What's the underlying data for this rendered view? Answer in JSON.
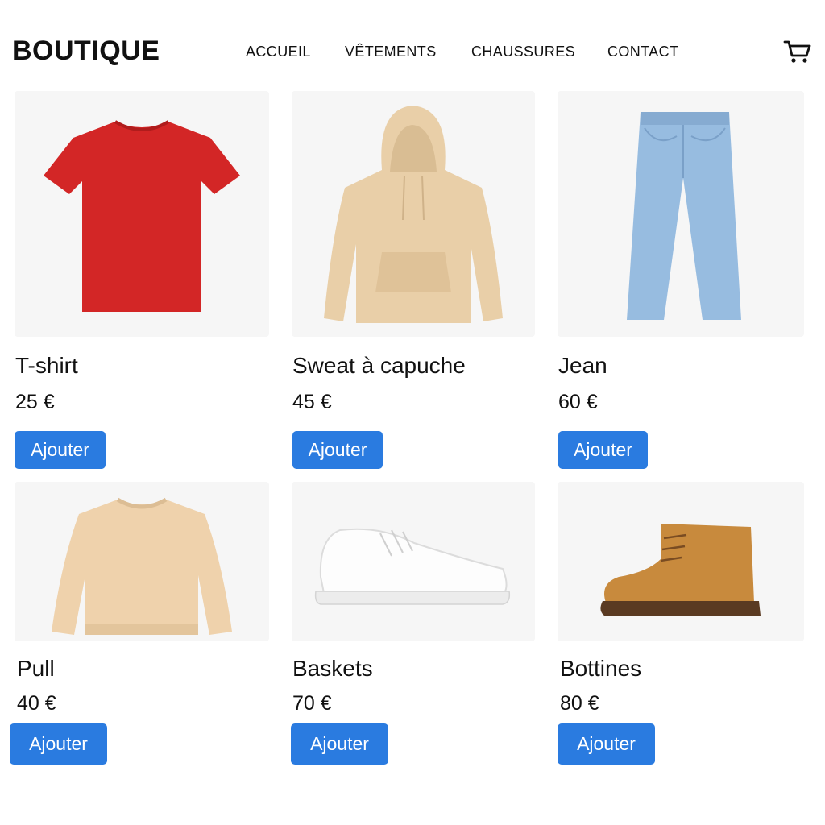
{
  "header": {
    "brand": "BOUTIQUE",
    "nav": [
      {
        "label": "ACCUEIL"
      },
      {
        "label": "VÊTEMENTS"
      },
      {
        "label": "CHAUSSURES"
      },
      {
        "label": "CONTACT"
      }
    ],
    "cart_icon": "shopping-cart-icon"
  },
  "colors": {
    "button": "#2a7be0",
    "text": "#111111",
    "image_bg": "#f6f6f6"
  },
  "products": [
    {
      "name": "T-shirt",
      "price": "25 €",
      "button": "Ajouter",
      "image": "red-tshirt"
    },
    {
      "name": "Sweat à capuche",
      "price": "45 €",
      "button": "Ajouter",
      "image": "beige-hoodie"
    },
    {
      "name": "Jean",
      "price": "60 €",
      "button": "Ajouter",
      "image": "blue-jeans"
    },
    {
      "name": "Pull",
      "price": "40 €",
      "button": "Ajouter",
      "image": "beige-sweater"
    },
    {
      "name": "Baskets",
      "price": "70 €",
      "button": "Ajouter",
      "image": "white-sneakers"
    },
    {
      "name": "Bottines",
      "price": "80 €",
      "button": "Ajouter",
      "image": "tan-ankle-boots"
    }
  ]
}
